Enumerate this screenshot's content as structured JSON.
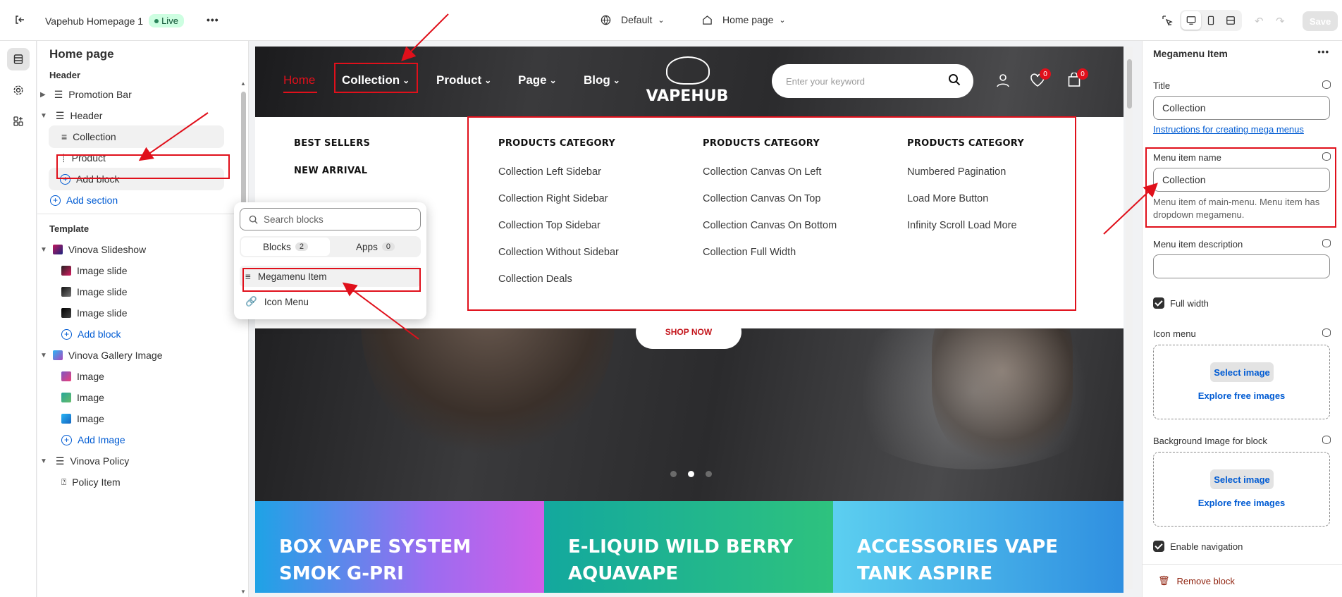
{
  "topbar": {
    "title": "Vapehub Homepage 1",
    "live": "Live",
    "theme_select": "Default",
    "page_select": "Home page",
    "save": "Save"
  },
  "left": {
    "title": "Home page",
    "header_group": "Header",
    "promotion_bar": "Promotion Bar",
    "header": "Header",
    "collection": "Collection",
    "product": "Product",
    "add_block": "Add block",
    "add_section": "Add section",
    "template_group": "Template",
    "slideshow": "Vinova Slideshow",
    "slide1": "Image slide",
    "slide2": "Image slide",
    "slide3": "Image slide",
    "add_block2": "Add block",
    "gallery": "Vinova Gallery Image",
    "image1": "Image",
    "image2": "Image",
    "image3": "Image",
    "add_image": "Add Image",
    "policy": "Vinova Policy",
    "policy_item": "Policy Item"
  },
  "popup": {
    "search_placeholder": "Search blocks",
    "tab_blocks": "Blocks",
    "tab_blocks_count": "2",
    "tab_apps": "Apps",
    "tab_apps_count": "0",
    "item1": "Megamenu Item",
    "item2": "Icon Menu"
  },
  "site": {
    "nav": [
      "Home",
      "Collection",
      "Product",
      "Page",
      "Blog"
    ],
    "logo": "VAPEHUB",
    "search_placeholder": "Enter your keyword",
    "wishlist_count": "0",
    "cart_count": "0",
    "shop_now": "SHOP NOW",
    "mega": {
      "col1": [
        "BEST SELLERS",
        "NEW ARRIVAL"
      ],
      "col2": {
        "head": "PRODUCTS CATEGORY",
        "links": [
          "Collection Left Sidebar",
          "Collection Right Sidebar",
          "Collection Top Sidebar",
          "Collection Without Sidebar",
          "Collection Deals"
        ]
      },
      "col3": {
        "head": "PRODUCTS CATEGORY",
        "links": [
          "Collection Canvas On Left",
          "Collection Canvas On Top",
          "Collection Canvas On Bottom",
          "Collection Full Width"
        ]
      },
      "col4": {
        "head": "PRODUCTS CATEGORY",
        "links": [
          "Numbered Pagination",
          "Load More Button",
          "Infinity Scroll Load More"
        ]
      }
    },
    "banners": [
      {
        "line1": "BOX VAPE SYSTEM",
        "line2": "SMOK G-PRI",
        "color": "#7f7bea"
      },
      {
        "line1": "E-LIQUID WILD BERRY",
        "line2": "AQUAVAPE",
        "color": "#1fb38a"
      },
      {
        "line1": "ACCESSORIES VAPE",
        "line2": "TANK ASPIRE",
        "color": "#3aa8ea"
      }
    ]
  },
  "right": {
    "title": "Megamenu Item",
    "title_label": "Title",
    "title_value": "Collection",
    "instructions": "Instructions for creating mega menus",
    "name_label": "Menu item name",
    "name_value": "Collection",
    "name_help": "Menu item of main-menu. Menu item has dropdown megamenu.",
    "desc_label": "Menu item description",
    "desc_value": "",
    "full_width": "Full width",
    "icon_label": "Icon menu",
    "select_image": "Select image",
    "explore": "Explore free images",
    "bg_label": "Background Image for block",
    "select_image2": "Select image",
    "explore2": "Explore free images",
    "enable_nav": "Enable navigation",
    "remove": "Remove block"
  },
  "colors": {
    "accent": "#005bd3",
    "annotation": "#e0101b",
    "home_red": "#e0101b"
  }
}
